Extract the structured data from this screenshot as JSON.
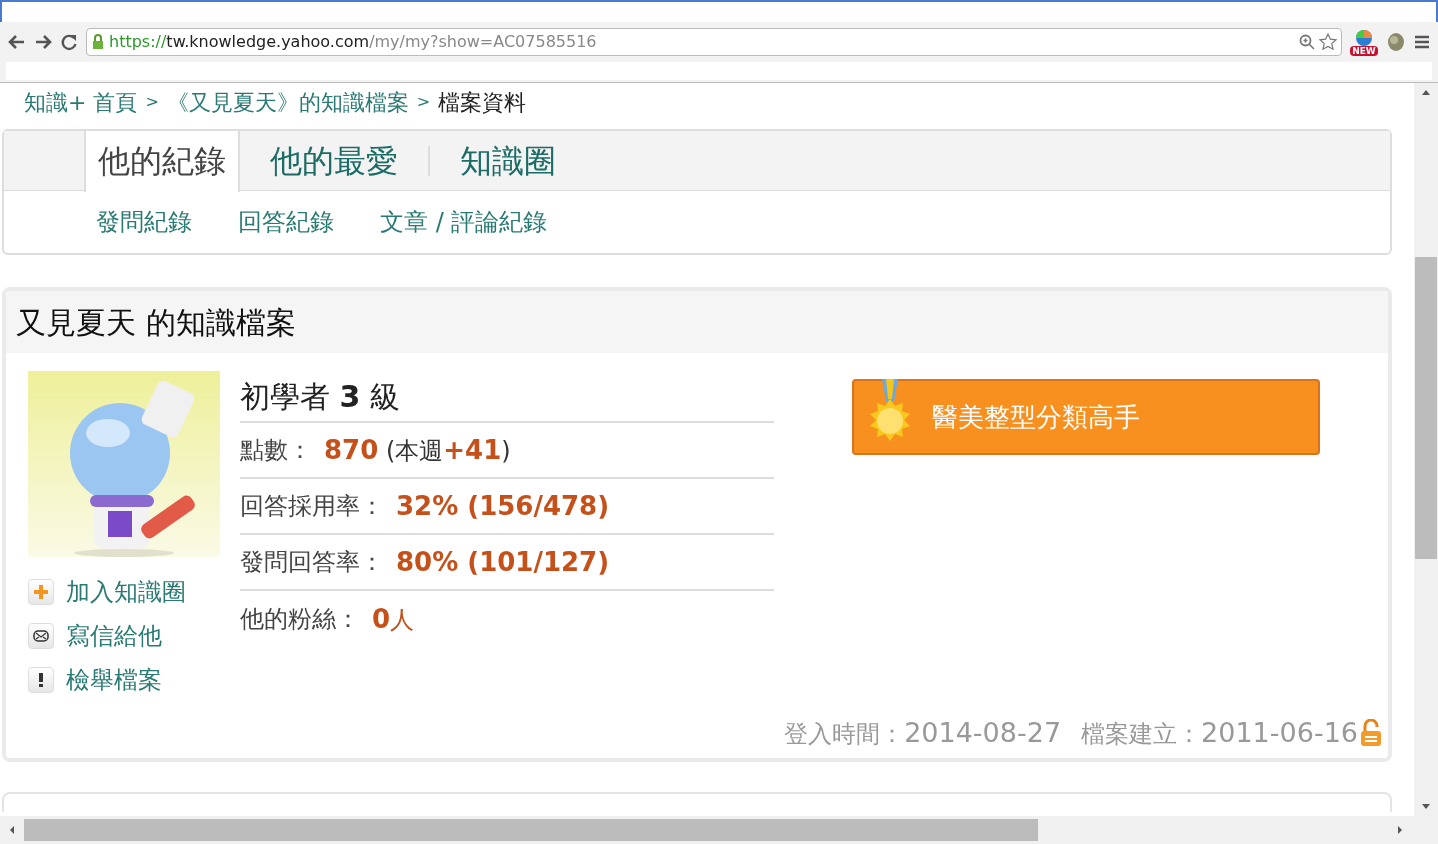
{
  "browser": {
    "url_scheme": "https://",
    "url_host": "tw.knowledge.yahoo.com",
    "url_path": "/my/my?show=AC07585516",
    "extension_badge": "NEW"
  },
  "breadcrumb": [
    {
      "label": "知識+ 首頁",
      "kind": "link"
    },
    {
      "label": ">",
      "kind": "sep"
    },
    {
      "label": "《又見夏天》的知識檔案",
      "kind": "link"
    },
    {
      "label": ">",
      "kind": "sep"
    },
    {
      "label": "檔案資料",
      "kind": "current"
    }
  ],
  "tabs": [
    {
      "label": "他的紀錄",
      "selected": true
    },
    {
      "label": "他的最愛",
      "selected": false
    },
    {
      "label": "知識圈",
      "selected": false
    }
  ],
  "subtabs": [
    "發問紀錄",
    "回答紀錄",
    "文章 / 評論紀錄"
  ],
  "profile": {
    "title": "又見夏天 的知識檔案",
    "level": "初學者 **3** 級",
    "stats": [
      {
        "label": "點數：",
        "parts": [
          {
            "text": "870",
            "kind": "value"
          },
          {
            "text": " (本週",
            "kind": "plain"
          },
          {
            "text": "+41",
            "kind": "value"
          },
          {
            "text": ")",
            "kind": "plain"
          }
        ]
      },
      {
        "label": "回答採用率：",
        "parts": [
          {
            "text": "32% (156/478)",
            "kind": "value"
          }
        ]
      },
      {
        "label": "發問回答率：",
        "parts": [
          {
            "text": "80% (101/127)",
            "kind": "value"
          }
        ]
      },
      {
        "label": "他的粉絲：",
        "parts": [
          {
            "text": "0",
            "kind": "value"
          },
          {
            "text": "人",
            "kind": "unit"
          }
        ]
      }
    ],
    "actions": [
      {
        "label": "加入知識圈",
        "kind": "add"
      },
      {
        "label": "寫信給他",
        "kind": "mail"
      },
      {
        "label": "檢舉檔案",
        "kind": "report"
      }
    ],
    "badge": "醫美整型分類高手",
    "login_label": "登入時間：",
    "login_date": "2014-08-27",
    "created_label": "檔案建立：",
    "created_date": "2011-06-16"
  }
}
